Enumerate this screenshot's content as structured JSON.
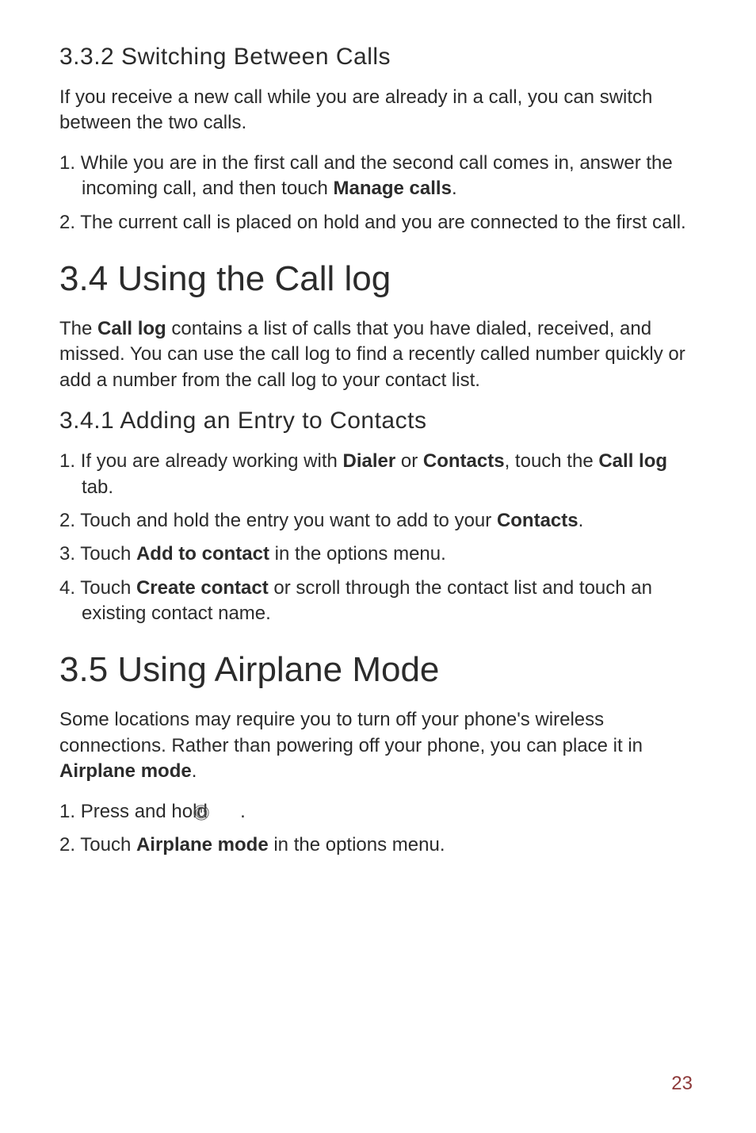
{
  "sections": {
    "s332": {
      "heading": "3.3.2  Switching Between Calls",
      "intro": "If you receive a new call while you are already in a call, you can switch between the two calls.",
      "items": [
        {
          "prefix": "1. ",
          "before": "While you are in the first call and the second call comes in, answer the incoming call, and then touch ",
          "bold": "Manage calls",
          "after": "."
        },
        {
          "prefix": "2. ",
          "before": "The current call is placed on hold and you are connected to the first call.",
          "bold": "",
          "after": ""
        }
      ]
    },
    "s34": {
      "heading": "3.4  Using the Call log",
      "intro_before": "The ",
      "intro_bold": "Call log",
      "intro_after": " contains a list of calls that you have dialed, received, and missed. You can use the call log to find a recently called number quickly or add a number from the call log to your contact list."
    },
    "s341": {
      "heading": "3.4.1  Adding an Entry to Contacts",
      "items": [
        {
          "prefix": "1. ",
          "parts": [
            {
              "t": "If you are already working with "
            },
            {
              "t": "Dialer",
              "b": true
            },
            {
              "t": " or "
            },
            {
              "t": "Contacts",
              "b": true
            },
            {
              "t": ", touch the "
            },
            {
              "t": "Call log",
              "b": true
            },
            {
              "t": " tab."
            }
          ]
        },
        {
          "prefix": "2. ",
          "parts": [
            {
              "t": "Touch and hold the entry you want to add to your "
            },
            {
              "t": "Contacts",
              "b": true
            },
            {
              "t": "."
            }
          ]
        },
        {
          "prefix": "3. ",
          "parts": [
            {
              "t": "Touch "
            },
            {
              "t": "Add to contact",
              "b": true
            },
            {
              "t": " in the options menu."
            }
          ]
        },
        {
          "prefix": "4. ",
          "parts": [
            {
              "t": "Touch "
            },
            {
              "t": "Create contact",
              "b": true
            },
            {
              "t": " or scroll through the contact list and touch an existing contact name."
            }
          ]
        }
      ]
    },
    "s35": {
      "heading": "3.5  Using Airplane Mode",
      "intro_before": "Some locations may require you to turn off your phone's wireless connections. Rather than powering off your phone, you can place it in ",
      "intro_bold": "Airplane mode",
      "intro_after": ".",
      "items": [
        {
          "prefix": "1. ",
          "before": "Press and hold ",
          "icon": true,
          "after": " ."
        },
        {
          "prefix": "2. ",
          "parts": [
            {
              "t": "Touch "
            },
            {
              "t": "Airplane mode",
              "b": true
            },
            {
              "t": " in the options menu."
            }
          ]
        }
      ]
    }
  },
  "page_number": "23"
}
